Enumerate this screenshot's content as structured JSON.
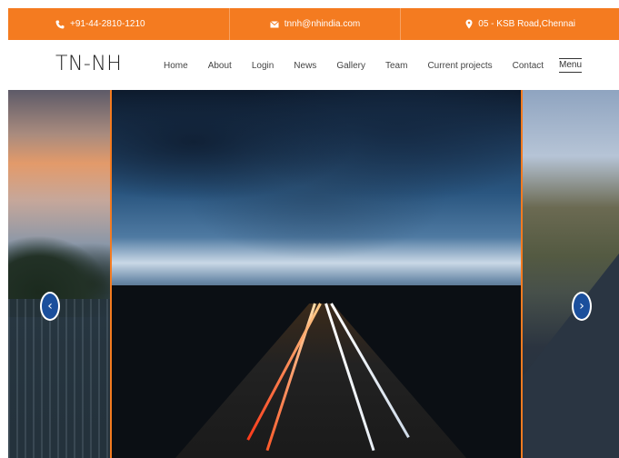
{
  "topbar": {
    "phone": "+91-44-2810-1210",
    "email": "tnnh@nhindia.com",
    "address": "05 - KSB Road,Chennai"
  },
  "header": {
    "logo": "TN-NH",
    "nav": [
      "Home",
      "About",
      "Login",
      "News",
      "Gallery",
      "Team",
      "Current projects",
      "Contact"
    ],
    "menu_label": "Menu"
  },
  "slider": {
    "prev_glyph": "‹",
    "next_glyph": "›"
  },
  "colors": {
    "accent": "#f47b20",
    "arrow": "#1b4f9c"
  }
}
